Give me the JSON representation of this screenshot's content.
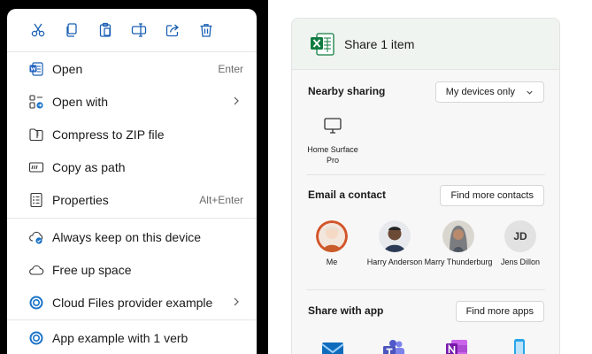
{
  "context_menu": {
    "toolbar": [
      {
        "name": "cut-icon"
      },
      {
        "name": "copy-icon"
      },
      {
        "name": "paste-icon"
      },
      {
        "name": "rename-icon"
      },
      {
        "name": "share-icon"
      },
      {
        "name": "delete-icon"
      }
    ],
    "items": [
      {
        "label": "Open",
        "shortcut": "Enter",
        "icon": "word-doc-icon"
      },
      {
        "label": "Open with",
        "shortcut": "",
        "icon": "open-with-icon",
        "submenu": true
      },
      {
        "label": "Compress to ZIP file",
        "shortcut": "",
        "icon": "zip-folder-icon"
      },
      {
        "label": "Copy as path",
        "shortcut": "",
        "icon": "copy-path-icon"
      },
      {
        "label": "Properties",
        "shortcut": "Alt+Enter",
        "icon": "properties-icon"
      },
      {
        "label": "Always keep on this device",
        "shortcut": "",
        "icon": "cloud-sync-icon"
      },
      {
        "label": "Free up space",
        "shortcut": "",
        "icon": "cloud-icon"
      },
      {
        "label": "Cloud Files provider example",
        "shortcut": "",
        "icon": "ring-icon",
        "submenu": true
      },
      {
        "label": "App example with 1 verb",
        "shortcut": "",
        "icon": "ring-icon"
      }
    ]
  },
  "share_panel": {
    "title": "Share 1 item",
    "nearby": {
      "label": "Nearby sharing",
      "dropdown": "My devices only",
      "devices": [
        {
          "name": "Home Surface Pro"
        }
      ]
    },
    "email": {
      "label": "Email a contact",
      "button": "Find more contacts",
      "contacts": [
        {
          "name": "Me"
        },
        {
          "name": "Harry Anderson"
        },
        {
          "name": "Marry Thunderburg"
        },
        {
          "name": "Jens Dillon",
          "initials": "JD"
        }
      ]
    },
    "apps": {
      "label": "Share with app",
      "button": "Find more apps",
      "items": [
        {
          "name": "mail-app-icon"
        },
        {
          "name": "teams-app-icon"
        },
        {
          "name": "onenote-app-icon"
        },
        {
          "name": "phone-app-icon"
        }
      ]
    },
    "colors": {
      "excel_green": "#107c41",
      "accent_blue": "#0f6cbd"
    }
  }
}
